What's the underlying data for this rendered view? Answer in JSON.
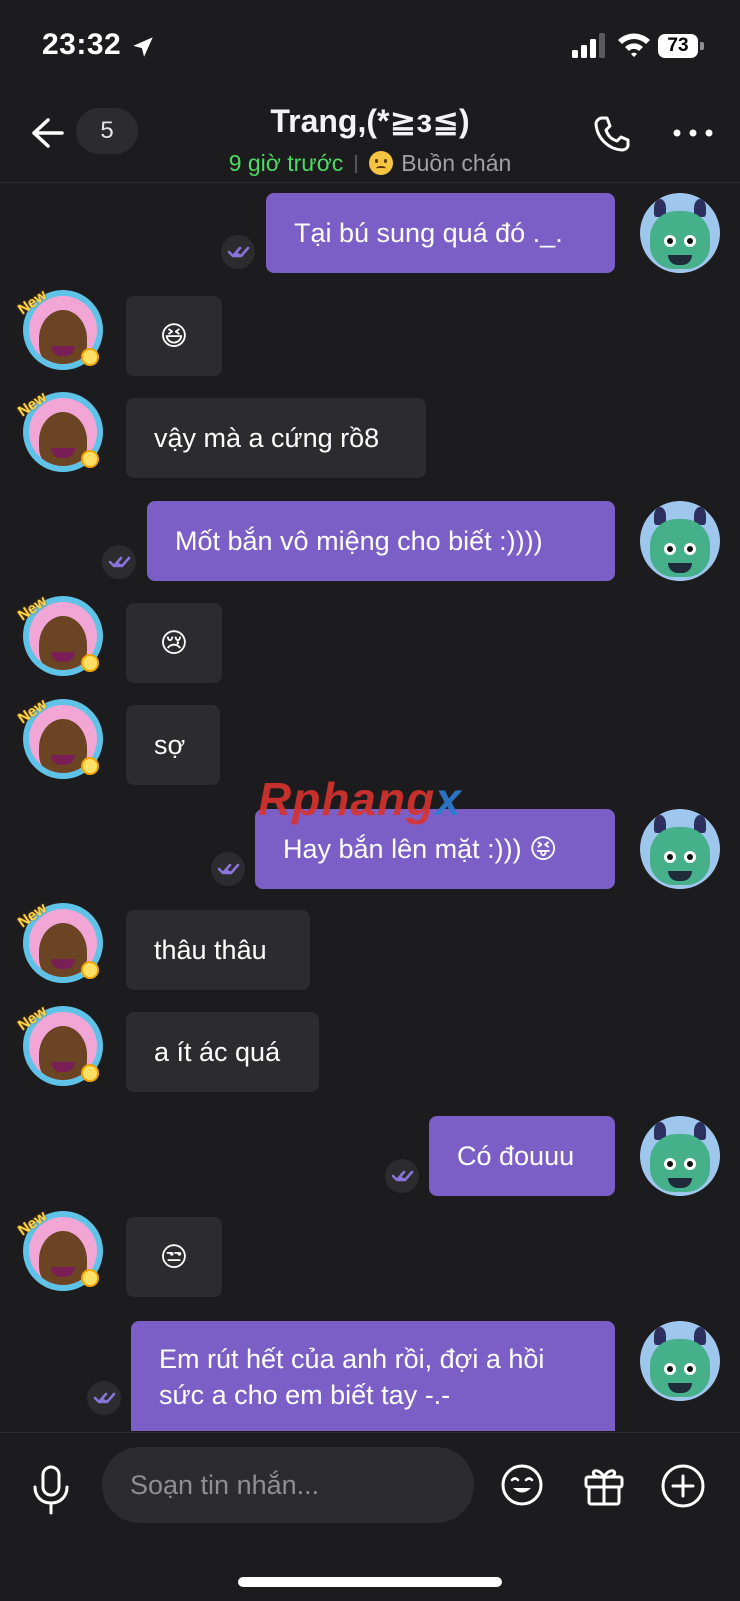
{
  "status": {
    "time": "23:32",
    "battery": "73"
  },
  "header": {
    "unread_count": "5",
    "contact_name": "Trang,(*≧з≦)",
    "last_seen": "9 giờ trước",
    "mood": "Buồn chán"
  },
  "messages": [
    {
      "direction": "out",
      "text": "Tại bú sung quá đó ._."
    },
    {
      "direction": "in",
      "text": "😆"
    },
    {
      "direction": "in",
      "text": "vậy mà a cứng rồ8"
    },
    {
      "direction": "out",
      "text": "Mốt bắn vô miệng cho biết :))))"
    },
    {
      "direction": "in",
      "text": "😢"
    },
    {
      "direction": "in",
      "text": "sợ"
    },
    {
      "direction": "out",
      "text": "Hay bắn lên mặt :))) 😝"
    },
    {
      "direction": "in",
      "text": "thâu thâu"
    },
    {
      "direction": "in",
      "text": "a ít ác quá"
    },
    {
      "direction": "out",
      "text": "Có đouuu"
    },
    {
      "direction": "in",
      "text": "😒"
    },
    {
      "direction": "out",
      "text": "Em rút hết của anh rồi, đợi a hồi sức a cho em biết tay -.-"
    }
  ],
  "watermark": {
    "main": "Rphang",
    "accent": "x"
  },
  "composer": {
    "placeholder": "Soạn tin nhắn..."
  },
  "colors": {
    "background": "#1c1c1e",
    "outgoing_bubble": "#7b5fc7",
    "incoming_bubble": "#2c2c2e",
    "online_green": "#4cd964"
  },
  "icons": [
    "location-arrow-icon",
    "signal-icon",
    "wifi-icon",
    "battery-icon",
    "back-arrow-icon",
    "phone-icon",
    "more-icon",
    "read-receipt-icon",
    "mic-icon",
    "emoji-icon",
    "gift-icon",
    "plus-icon"
  ]
}
